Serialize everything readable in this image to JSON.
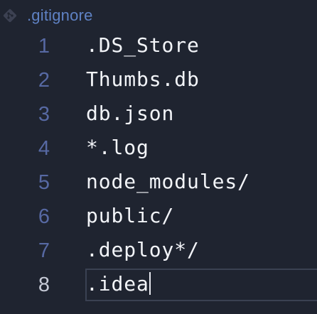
{
  "tab": {
    "file_name": ".gitignore",
    "icon": "git-diamond-icon"
  },
  "colors": {
    "background": "#1f2430",
    "line_number": "#5769a3",
    "line_number_active": "#c6cad6",
    "code_text": "#f2f4f8",
    "file_name": "#5f82c4"
  },
  "editor": {
    "active_line": 8,
    "lines": [
      {
        "number": "1",
        "text": ".DS_Store"
      },
      {
        "number": "2",
        "text": "Thumbs.db"
      },
      {
        "number": "3",
        "text": "db.json"
      },
      {
        "number": "4",
        "text": "*.log"
      },
      {
        "number": "5",
        "text": "node_modules/"
      },
      {
        "number": "6",
        "text": "public/"
      },
      {
        "number": "7",
        "text": ".deploy*/"
      },
      {
        "number": "8",
        "text": ".idea"
      }
    ]
  }
}
